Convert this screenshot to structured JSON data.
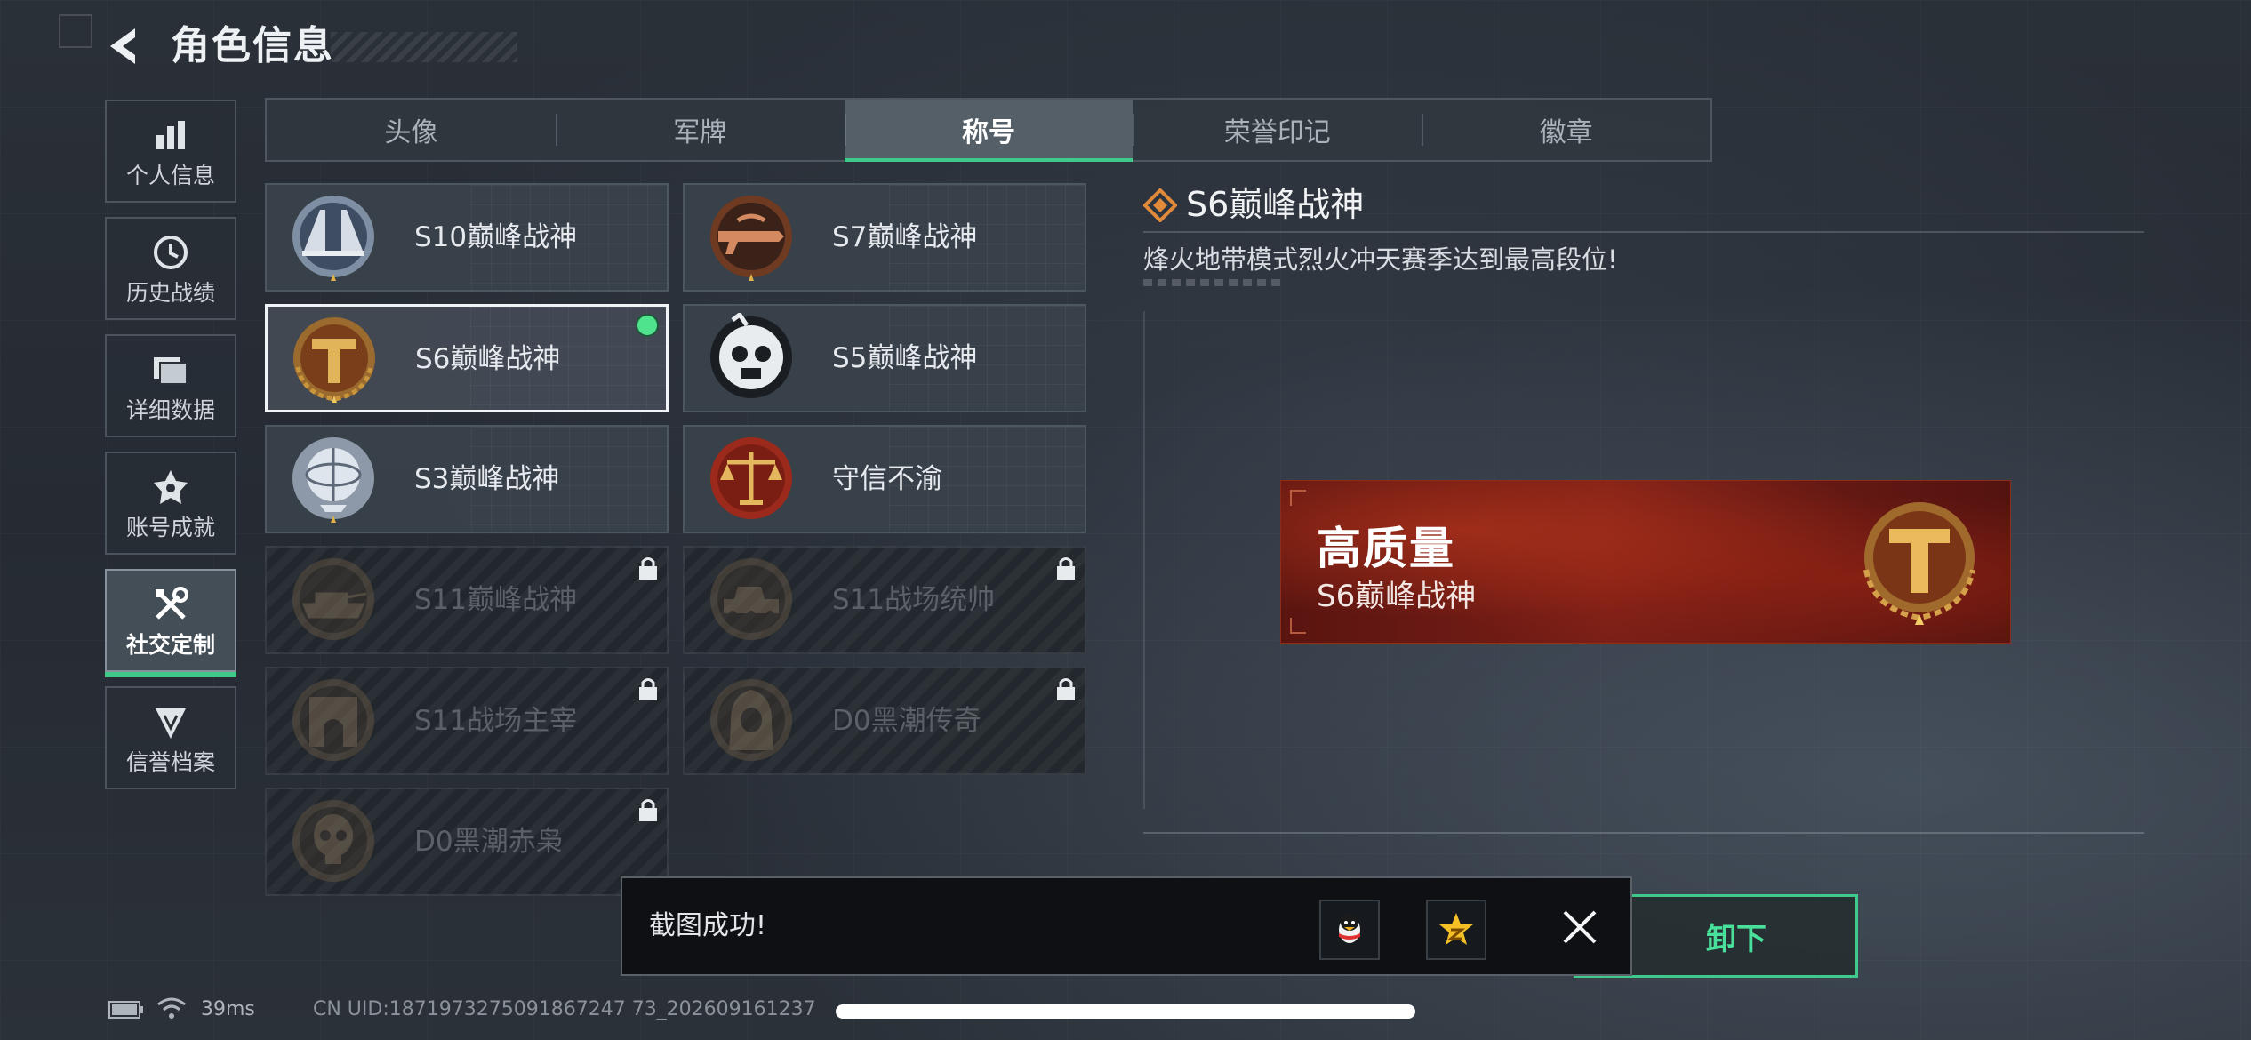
{
  "header": {
    "title": "角色信息"
  },
  "sidebar": {
    "items": [
      {
        "label": "个人信息",
        "icon": "bar-chart-icon"
      },
      {
        "label": "历史战绩",
        "icon": "clock-icon"
      },
      {
        "label": "详细数据",
        "icon": "folder-icon"
      },
      {
        "label": "账号成就",
        "icon": "achievement-icon"
      },
      {
        "label": "社交定制",
        "icon": "tools-icon",
        "active": true
      },
      {
        "label": "信誉档案",
        "icon": "shield-icon"
      }
    ]
  },
  "tabs": [
    {
      "label": "头像"
    },
    {
      "label": "军牌"
    },
    {
      "label": "称号",
      "active": true
    },
    {
      "label": "荣誉印记"
    },
    {
      "label": "徽章"
    }
  ],
  "titles": [
    {
      "name": "S10巅峰战神",
      "emblem": "silver-bridge-emblem",
      "locked": false
    },
    {
      "name": "S7巅峰战神",
      "emblem": "bronze-gun-emblem",
      "locked": false
    },
    {
      "name": "S6巅峰战神",
      "emblem": "gold-t-emblem",
      "locked": false,
      "selected": true,
      "equipped": true
    },
    {
      "name": "S5巅峰战神",
      "emblem": "skull-gasmask-emblem",
      "locked": false
    },
    {
      "name": "S3巅峰战神",
      "emblem": "silver-globe-emblem",
      "locked": false
    },
    {
      "name": "守信不渝",
      "emblem": "red-scales-emblem",
      "locked": false
    },
    {
      "name": "S11巅峰战神",
      "emblem": "tank-emblem",
      "locked": true
    },
    {
      "name": "S11战场统帅",
      "emblem": "armored-vehicle-emblem",
      "locked": true
    },
    {
      "name": "S11战场主宰",
      "emblem": "arch-emblem",
      "locked": true
    },
    {
      "name": "D0黑潮传奇",
      "emblem": "hooded-figure-emblem",
      "locked": true
    },
    {
      "name": "D0黑潮赤枭",
      "emblem": "skull-emblem",
      "locked": true
    }
  ],
  "detail": {
    "title": "S6巅峰战神",
    "description": "烽火地带模式烈火冲天赛季达到最高段位!",
    "preview_main": "高质量",
    "preview_sub": "S6巅峰战神",
    "button_label": "卸下"
  },
  "toast": {
    "message": "截图成功!",
    "share_icons": [
      "qq-penguin-icon",
      "qzone-star-icon"
    ]
  },
  "status": {
    "ping": "39ms",
    "uid": "CN UID:1871973275091867247 73_202609161237"
  },
  "colors": {
    "accent": "#3fc98a",
    "preview_red": "#7a1f17",
    "gold": "#c9953c"
  }
}
